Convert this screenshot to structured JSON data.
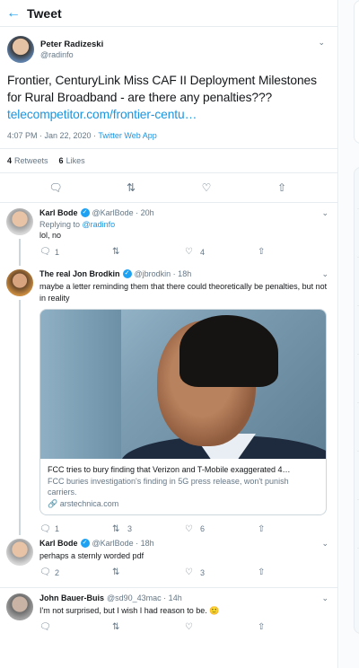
{
  "header": {
    "title": "Tweet"
  },
  "main_tweet": {
    "author_name": "Peter Radizeski",
    "author_handle": "@radinfo",
    "text": "Frontier, CenturyLink Miss CAF II Deployment Milestones for Rural Broadband - are there any penalties???",
    "link": "telecompetitor.com/frontier-centu…",
    "time": "4:07 PM · Jan 22, 2020 · ",
    "app": "Twitter Web App",
    "retweets_count": "4",
    "retweets_label": "Retweets",
    "likes_count": "6",
    "likes_label": "Likes"
  },
  "replies": [
    {
      "name": "Karl Bode",
      "handle": "@KarlBode · 20h",
      "replying_prefix": "Replying to ",
      "replying_to": "@radinfo",
      "text": "lol, no",
      "reply_count": "1",
      "retweet_count": "",
      "like_count": "4"
    },
    {
      "name": "The real Jon Brodkin",
      "handle": "@jbrodkin · 18h",
      "text": "maybe a letter reminding them that there could theoretically be penalties, but not in reality",
      "card_title": "FCC tries to bury finding that Verizon and T-Mobile exaggerated 4…",
      "card_desc": "FCC buries investigation's finding in 5G press release, won't punish carriers.",
      "card_domain": "arstechnica.com",
      "reply_count": "1",
      "retweet_count": "3",
      "like_count": "6"
    },
    {
      "name": "Karl Bode",
      "handle": "@KarlBode · 18h",
      "text": "perhaps a sternly worded pdf",
      "reply_count": "2",
      "retweet_count": "",
      "like_count": "3"
    },
    {
      "name": "John Bauer-Buis",
      "handle": "@sd90_43mac · 14h",
      "text": "I'm not surprised, but I wish I had reason to be. 🙂",
      "reply_count": "",
      "retweet_count": "",
      "like_count": ""
    }
  ],
  "icons": [
    "back-arrow-icon",
    "chevron-down-icon",
    "reply-icon",
    "retweet-icon",
    "like-icon",
    "share-icon",
    "verified-icon",
    "link-icon"
  ],
  "colors": {
    "accent": "#1da1f2",
    "link": "#1b95e0",
    "muted": "#657786",
    "border": "#e6ecf0"
  }
}
